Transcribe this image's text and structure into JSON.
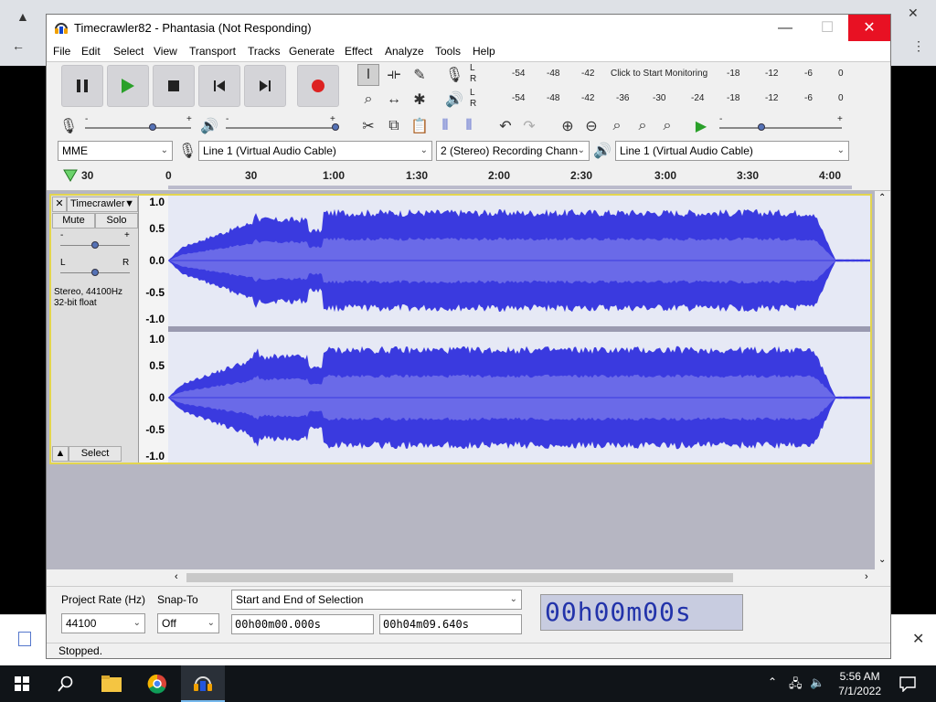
{
  "window": {
    "title": "Timecrawler82 - Phantasia (Not Responding)"
  },
  "menu": [
    "File",
    "Edit",
    "Select",
    "View",
    "Transport",
    "Tracks",
    "Generate",
    "Effect",
    "Analyze",
    "Tools",
    "Help"
  ],
  "meters": {
    "record_scale": [
      "-54",
      "-48",
      "-42",
      "Click to Start Monitoring",
      "-18",
      "-12",
      "-6",
      "0"
    ],
    "play_scale": [
      "-54",
      "-48",
      "-42",
      "-36",
      "-30",
      "-24",
      "-18",
      "-12",
      "-6",
      "0"
    ],
    "lr": [
      "L",
      "R"
    ]
  },
  "device": {
    "host": "MME",
    "recording_device": "Line 1 (Virtual Audio Cable)",
    "channels": "2 (Stereo) Recording Chann",
    "playback_device": "Line 1 (Virtual Audio Cable)"
  },
  "timeline": {
    "ticks": [
      "30",
      "0",
      "30",
      "1:00",
      "1:30",
      "2:00",
      "2:30",
      "3:00",
      "3:30",
      "4:00"
    ]
  },
  "track": {
    "name": "Timecrawler",
    "mute": "Mute",
    "solo": "Solo",
    "gain_minus": "-",
    "gain_plus": "+",
    "pan_left": "L",
    "pan_right": "R",
    "info_line1": "Stereo, 44100Hz",
    "info_line2": "32-bit float",
    "select": "Select",
    "ruler": [
      "1.0",
      "0.5",
      "0.0",
      "-0.5",
      "-1.0"
    ]
  },
  "selection": {
    "project_rate_label": "Project Rate (Hz)",
    "project_rate": "44100",
    "snap_label": "Snap-To",
    "snap": "Off",
    "mode": "Start and End of Selection",
    "start": "00h00m00.000s",
    "end": "00h04m09.640s",
    "audio_position": "00h00m00s"
  },
  "status": "Stopped.",
  "taskbar": {
    "time": "5:56 AM",
    "date": "7/1/2022"
  },
  "colors": {
    "wave_outer": "#3a3adf",
    "wave_inner": "#6a6ae8",
    "close_red": "#e81123",
    "selection_bg": "#e6e9f5"
  }
}
